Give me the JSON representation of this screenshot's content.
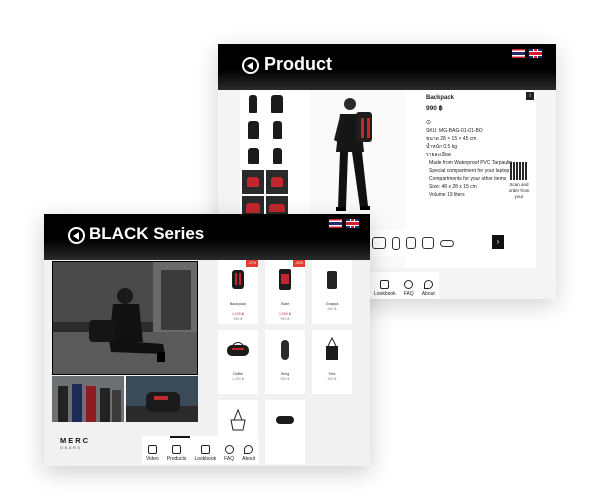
{
  "back_screen": {
    "title": "Product",
    "product": {
      "name": "Backpack",
      "price": "990 ฿",
      "sku": "SKU: MG-BAG-01-01-BO",
      "size": "ขนาด 28 × 15 × 45 cm",
      "weight": "น้ำหนัก 0.5 kg",
      "details_title": "รายละเอียด",
      "details": [
        "Made from Waterproof PVC Tarpaulin",
        "Special compartment for your laptop",
        "Compartments for your other items",
        "Size: 48 x 28 x 15 cm",
        "Volume 19 liters"
      ],
      "qr_caption": "Scan and order from your"
    },
    "nav": [
      "Lookbook",
      "FAQ",
      "About"
    ]
  },
  "front_screen": {
    "title": "BLACK Series",
    "products": [
      {
        "name": "Backpack",
        "price": "990 ฿",
        "old": "1,190 ฿",
        "sale": "-17%"
      },
      {
        "name": "Slate",
        "price": "990 ฿",
        "old": "1,290 ฿",
        "sale": "-23%"
      },
      {
        "name": "Grappa",
        "price": "590 ฿",
        "old": "",
        "sale": ""
      },
      {
        "name": "Duffle",
        "price": "1,290 ฿",
        "old": "",
        "sale": ""
      },
      {
        "name": "Sling",
        "price": "590 ฿",
        "old": "",
        "sale": ""
      },
      {
        "name": "Tote",
        "price": "490 ฿",
        "old": "",
        "sale": ""
      },
      {
        "name": "",
        "price": "",
        "old": "",
        "sale": ""
      },
      {
        "name": "",
        "price": "",
        "old": "",
        "sale": ""
      }
    ],
    "logo_top": "MERC",
    "logo_bottom": "GEARS",
    "nav": [
      "Video",
      "Products",
      "Lookbook",
      "FAQ",
      "About"
    ]
  },
  "colors": {
    "header": "#000000",
    "sale": "#e23a2f",
    "accent_red": "#c0282d"
  }
}
